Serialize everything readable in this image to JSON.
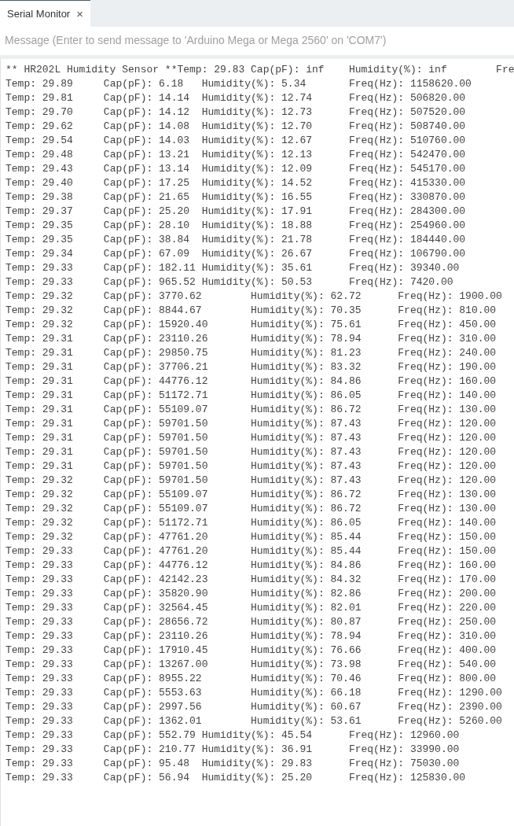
{
  "tabs": [
    {
      "label": "Serial Monitor",
      "close": "×",
      "selected": true
    }
  ],
  "message": {
    "placeholder": "Message (Enter to send message to 'Arduino Mega or Mega 2560' on 'COM7')"
  },
  "output": {
    "lines": [
      "** HR202L Humidity Sensor **Temp: 29.83 Cap(pF): inf\tHumidity(%): inf\tFre",
      "Temp: 29.89\tCap(pF): 6.18\tHumidity(%): 5.34\tFreq(Hz): 1158620.00",
      "Temp: 29.81\tCap(pF): 14.14\tHumidity(%): 12.74\tFreq(Hz): 506820.00",
      "Temp: 29.70\tCap(pF): 14.12\tHumidity(%): 12.73\tFreq(Hz): 507520.00",
      "Temp: 29.62\tCap(pF): 14.08\tHumidity(%): 12.70\tFreq(Hz): 508740.00",
      "Temp: 29.54\tCap(pF): 14.03\tHumidity(%): 12.67\tFreq(Hz): 510760.00",
      "Temp: 29.48\tCap(pF): 13.21\tHumidity(%): 12.13\tFreq(Hz): 542470.00",
      "Temp: 29.43\tCap(pF): 13.14\tHumidity(%): 12.09\tFreq(Hz): 545170.00",
      "Temp: 29.40\tCap(pF): 17.25\tHumidity(%): 14.52\tFreq(Hz): 415330.00",
      "Temp: 29.38\tCap(pF): 21.65\tHumidity(%): 16.55\tFreq(Hz): 330870.00",
      "Temp: 29.37\tCap(pF): 25.20\tHumidity(%): 17.91\tFreq(Hz): 284300.00",
      "Temp: 29.35\tCap(pF): 28.10\tHumidity(%): 18.88\tFreq(Hz): 254960.00",
      "Temp: 29.35\tCap(pF): 38.84\tHumidity(%): 21.78\tFreq(Hz): 184440.00",
      "Temp: 29.34\tCap(pF): 67.09\tHumidity(%): 26.67\tFreq(Hz): 106790.00",
      "Temp: 29.33\tCap(pF): 182.11 Humidity(%): 35.61\tFreq(Hz): 39340.00",
      "Temp: 29.33\tCap(pF): 965.52 Humidity(%): 50.53\tFreq(Hz): 7420.00",
      "Temp: 29.32\tCap(pF): 3770.62\tHumidity(%): 62.72\tFreq(Hz): 1900.00",
      "Temp: 29.32\tCap(pF): 8844.67\tHumidity(%): 70.35\tFreq(Hz): 810.00",
      "Temp: 29.32\tCap(pF): 15920.40\tHumidity(%): 75.61\tFreq(Hz): 450.00",
      "Temp: 29.31\tCap(pF): 23110.26\tHumidity(%): 78.94\tFreq(Hz): 310.00",
      "Temp: 29.31\tCap(pF): 29850.75\tHumidity(%): 81.23\tFreq(Hz): 240.00",
      "Temp: 29.31\tCap(pF): 37706.21\tHumidity(%): 83.32\tFreq(Hz): 190.00",
      "Temp: 29.31\tCap(pF): 44776.12\tHumidity(%): 84.86\tFreq(Hz): 160.00",
      "Temp: 29.31\tCap(pF): 51172.71\tHumidity(%): 86.05\tFreq(Hz): 140.00",
      "Temp: 29.31\tCap(pF): 55109.07\tHumidity(%): 86.72\tFreq(Hz): 130.00",
      "Temp: 29.31\tCap(pF): 59701.50\tHumidity(%): 87.43\tFreq(Hz): 120.00",
      "Temp: 29.31\tCap(pF): 59701.50\tHumidity(%): 87.43\tFreq(Hz): 120.00",
      "Temp: 29.31\tCap(pF): 59701.50\tHumidity(%): 87.43\tFreq(Hz): 120.00",
      "Temp: 29.31\tCap(pF): 59701.50\tHumidity(%): 87.43\tFreq(Hz): 120.00",
      "Temp: 29.32\tCap(pF): 59701.50\tHumidity(%): 87.43\tFreq(Hz): 120.00",
      "Temp: 29.32\tCap(pF): 55109.07\tHumidity(%): 86.72\tFreq(Hz): 130.00",
      "Temp: 29.32\tCap(pF): 55109.07\tHumidity(%): 86.72\tFreq(Hz): 130.00",
      "Temp: 29.32\tCap(pF): 51172.71\tHumidity(%): 86.05\tFreq(Hz): 140.00",
      "Temp: 29.32\tCap(pF): 47761.20\tHumidity(%): 85.44\tFreq(Hz): 150.00",
      "Temp: 29.33\tCap(pF): 47761.20\tHumidity(%): 85.44\tFreq(Hz): 150.00",
      "Temp: 29.33\tCap(pF): 44776.12\tHumidity(%): 84.86\tFreq(Hz): 160.00",
      "Temp: 29.33\tCap(pF): 42142.23\tHumidity(%): 84.32\tFreq(Hz): 170.00",
      "Temp: 29.33\tCap(pF): 35820.90\tHumidity(%): 82.86\tFreq(Hz): 200.00",
      "Temp: 29.33\tCap(pF): 32564.45\tHumidity(%): 82.01\tFreq(Hz): 220.00",
      "Temp: 29.33\tCap(pF): 28656.72\tHumidity(%): 80.87\tFreq(Hz): 250.00",
      "Temp: 29.33\tCap(pF): 23110.26\tHumidity(%): 78.94\tFreq(Hz): 310.00",
      "Temp: 29.33\tCap(pF): 17910.45\tHumidity(%): 76.66\tFreq(Hz): 400.00",
      "Temp: 29.33\tCap(pF): 13267.00\tHumidity(%): 73.98\tFreq(Hz): 540.00",
      "Temp: 29.33\tCap(pF): 8955.22\tHumidity(%): 70.46\tFreq(Hz): 800.00",
      "Temp: 29.33\tCap(pF): 5553.63\tHumidity(%): 66.18\tFreq(Hz): 1290.00",
      "Temp: 29.33\tCap(pF): 2997.56\tHumidity(%): 60.67\tFreq(Hz): 2390.00",
      "Temp: 29.33\tCap(pF): 1362.01\tHumidity(%): 53.61\tFreq(Hz): 5260.00",
      "Temp: 29.33\tCap(pF): 552.79 Humidity(%): 45.54\tFreq(Hz): 12960.00",
      "Temp: 29.33\tCap(pF): 210.77 Humidity(%): 36.91\tFreq(Hz): 33990.00",
      "Temp: 29.33\tCap(pF): 95.48\tHumidity(%): 29.83\tFreq(Hz): 75030.00",
      "Temp: 29.33\tCap(pF): 56.94\tHumidity(%): 25.20\tFreq(Hz): 125830.00"
    ]
  }
}
